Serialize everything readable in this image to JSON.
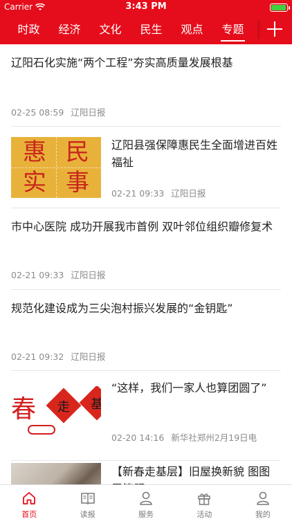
{
  "status_bar": {
    "carrier": "Carrier",
    "time": "3:43 PM",
    "battery_level": 0.95
  },
  "nav": {
    "tabs": [
      {
        "label": "时政",
        "active": false
      },
      {
        "label": "经济",
        "active": false
      },
      {
        "label": "文化",
        "active": false
      },
      {
        "label": "民生",
        "active": false
      },
      {
        "label": "观点",
        "active": false
      },
      {
        "label": "专题",
        "active": true
      }
    ]
  },
  "articles": [
    {
      "title": "辽阳石化实施“两个工程”夯实高质量发展根基",
      "time": "02-25 08:59",
      "source": "辽阳日报"
    },
    {
      "title": "辽阳县强保障惠民生全面增进百姓福祉",
      "time": "02-21 09:33",
      "source": "辽阳日报",
      "image_text": [
        "惠",
        "民",
        "实",
        "事"
      ]
    },
    {
      "title": "市中心医院 成功开展我市首例 双叶邻位组织瓣修复术",
      "time": "02-21 09:33",
      "source": "辽阳日报"
    },
    {
      "title": "规范化建设成为三尖泡村振兴发展的“金钥匙”",
      "time": "02-21 09:32",
      "source": "辽阳日报"
    },
    {
      "title": "“这样，我们一家人也算团圆了”",
      "time": "02-20 14:16",
      "source": "新华社郑州2月19日电",
      "image_text": [
        "春",
        "走",
        "基"
      ]
    },
    {
      "title": "【新春走基层】旧屋换新貌 图图层篇题",
      "time": "",
      "source": ""
    }
  ],
  "tabbar": [
    {
      "label": "首页",
      "icon": "home-icon",
      "active": true
    },
    {
      "label": "读报",
      "icon": "book-icon",
      "active": false
    },
    {
      "label": "服务",
      "icon": "person-icon",
      "active": false
    },
    {
      "label": "活动",
      "icon": "gift-icon",
      "active": false
    },
    {
      "label": "我的",
      "icon": "user-icon",
      "active": false
    }
  ],
  "colors": {
    "brand_red": "#e50d1b",
    "meta_gray": "#8a8a8a"
  }
}
